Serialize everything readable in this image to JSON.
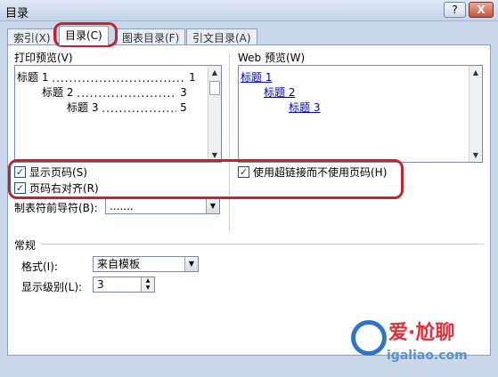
{
  "window": {
    "title": "目录",
    "help_label": "?",
    "close_label": "X"
  },
  "tabs": [
    {
      "label": "索引(X)",
      "active": false
    },
    {
      "label": "目录(C)",
      "active": true
    },
    {
      "label": "图表目录(F)",
      "active": false
    },
    {
      "label": "引文目录(A)",
      "active": false
    }
  ],
  "print_preview": {
    "label": "打印预览(V)",
    "entries": [
      {
        "text": "标题 1",
        "page": "1"
      },
      {
        "text": "标题 2",
        "page": "3"
      },
      {
        "text": "标题 3",
        "page": "5"
      }
    ]
  },
  "web_preview": {
    "label": "Web 预览(W)",
    "entries": [
      "标题 1",
      "标题 2",
      "标题 3"
    ]
  },
  "options": {
    "show_page_numbers": {
      "label": "显示页码(S)",
      "checked": true
    },
    "right_align": {
      "label": "页码右对齐(R)",
      "checked": true
    },
    "use_hyperlinks": {
      "label": "使用超链接而不使用页码(H)",
      "checked": true
    },
    "tab_leader_label": "制表符前导符(B):",
    "tab_leader_value": "......."
  },
  "general": {
    "section_label": "常规",
    "format_label": "格式(I):",
    "format_value": "来自模板",
    "levels_label": "显示级别(L):",
    "levels_value": "3"
  },
  "watermark": {
    "text": "爱·尬聊",
    "url": "igaliao.com"
  },
  "colors": {
    "highlight": "#c0242c",
    "link": "#0000cc"
  }
}
